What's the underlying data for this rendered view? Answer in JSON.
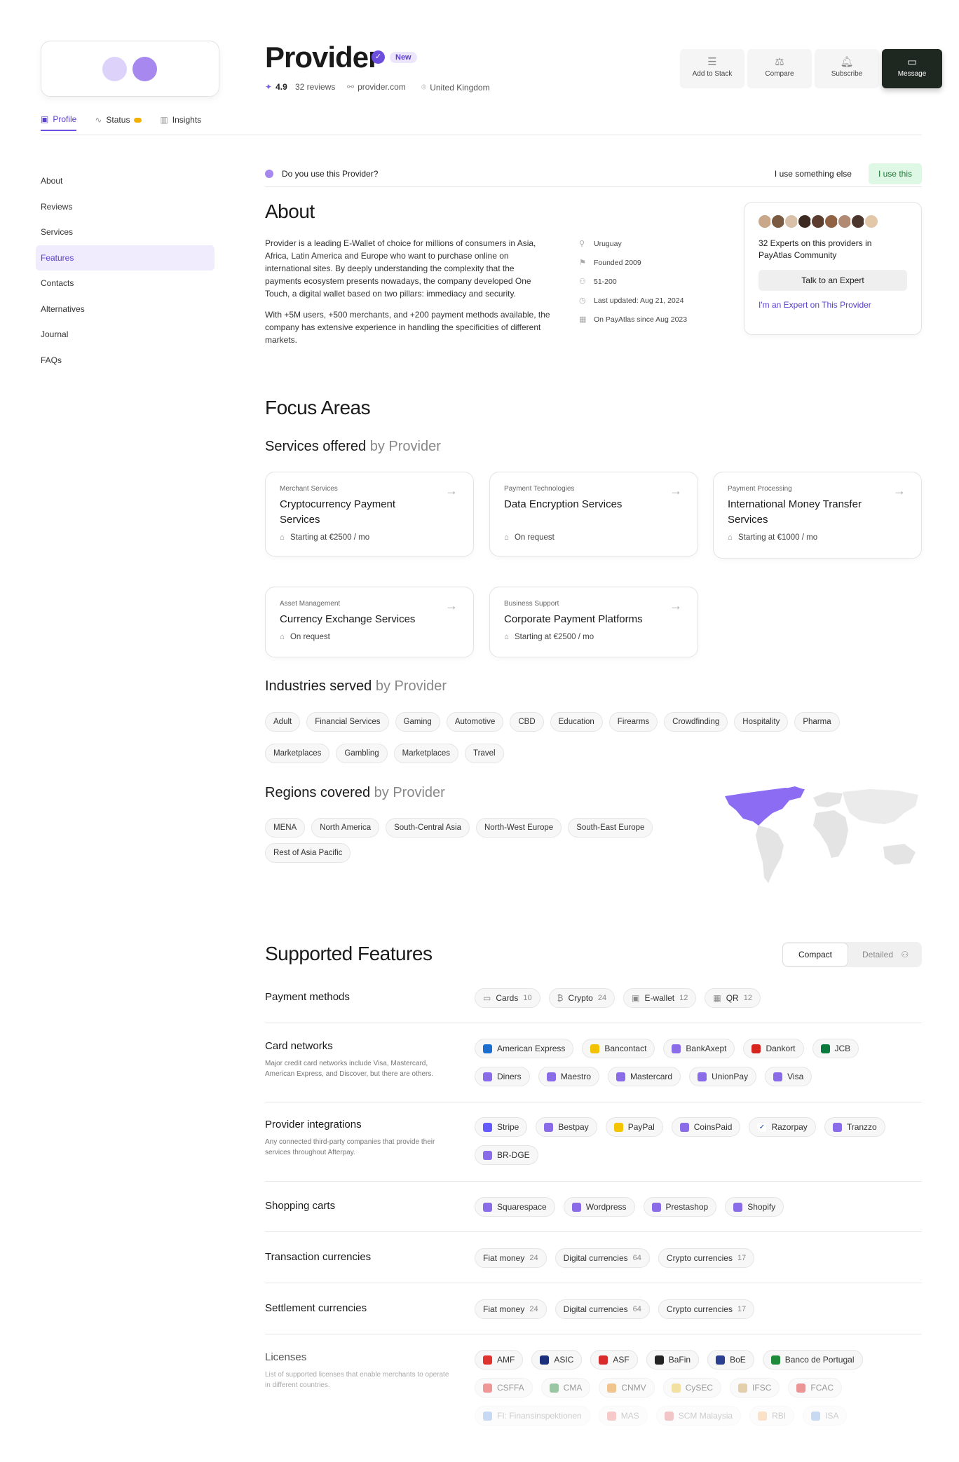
{
  "header": {
    "title": "Provider",
    "badge": "New",
    "rating": "4.9",
    "reviews": "32 reviews",
    "website": "provider.com",
    "country": "United Kingdom"
  },
  "actions": {
    "add_to_stack": "Add to Stack",
    "compare": "Compare",
    "subscribe": "Subscribe",
    "message": "Message"
  },
  "tabs": [
    {
      "label": "Profile"
    },
    {
      "label": "Status"
    },
    {
      "label": "Insights"
    }
  ],
  "sidebar": {
    "items": [
      {
        "label": "About"
      },
      {
        "label": "Reviews"
      },
      {
        "label": "Services"
      },
      {
        "label": "Features"
      },
      {
        "label": "Contacts"
      },
      {
        "label": "Alternatives"
      },
      {
        "label": "Journal"
      },
      {
        "label": "FAQs"
      }
    ]
  },
  "use_question": {
    "text": "Do you use this Provider?",
    "else_label": "I use something else",
    "use_label": "I use this"
  },
  "about": {
    "title": "About",
    "p1": "Provider is a leading E-Wallet of choice for millions of consumers in Asia, Africa, Latin America and Europe who want to purchase online on international sites. By deeply understanding the complexity that the payments ecosystem presents nowadays, the company developed One Touch, a digital wallet based on two pillars: immediacy and security.",
    "p2": "With +5M users, +500 merchants, and +200 payment methods available, the company has extensive experience in handling the specificities of different markets.",
    "facts": [
      "Uruguay",
      "Founded 2009",
      "51-200",
      "Last updated: Aug 21, 2024",
      "On PayAtlas since Aug 2023"
    ]
  },
  "experts": {
    "text": "32 Experts on this providers in PayAtlas Community",
    "talk": "Talk to an Expert",
    "link": "I'm an Expert on This Provider",
    "avatar_colors": [
      "#c9a78a",
      "#7a5a40",
      "#d8c1a8",
      "#3c2a22",
      "#5b3d2f",
      "#8e6242",
      "#b08a72",
      "#4a362c",
      "#e3c7a9"
    ]
  },
  "focus": {
    "title": "Focus Areas",
    "services_title": "Services offered",
    "by": "by Provider",
    "services": [
      {
        "category": "Merchant Services",
        "name": "Cryptocurrency Payment Services",
        "price": "Starting at €2500 / mo"
      },
      {
        "category": "Payment Technologies",
        "name": "Data Encryption Services",
        "price": "On request"
      },
      {
        "category": "Payment Processing",
        "name": "International Money Transfer Services",
        "price": "Starting at €1000 / mo"
      },
      {
        "category": "Asset Management",
        "name": "Currency Exchange Services",
        "price": "On request"
      },
      {
        "category": "Business Support",
        "name": "Corporate Payment Platforms",
        "price": "Starting at €2500 / mo"
      }
    ],
    "industries_title": "Industries served",
    "industries": [
      "Adult",
      "Financial Services",
      "Gaming",
      "Automotive",
      "CBD",
      "Education",
      "Firearms",
      "Crowdfinding",
      "Hospitality",
      "Pharma",
      "Marketplaces",
      "Gambling",
      "Marketplaces",
      "Travel"
    ],
    "regions_title": "Regions covered",
    "regions": [
      "MENA",
      "North America",
      "South-Central Asia",
      "North-West Europe",
      "South-East Europe",
      "Rest of Asia Pacific"
    ]
  },
  "features": {
    "title": "Supported Features",
    "seg_compact": "Compact",
    "seg_detailed": "Detailed",
    "payment_methods": {
      "label": "Payment methods",
      "items": [
        {
          "n": "Cards",
          "c": "10"
        },
        {
          "n": "Crypto",
          "c": "24"
        },
        {
          "n": "E-wallet",
          "c": "12"
        },
        {
          "n": "QR",
          "c": "12"
        }
      ]
    },
    "card_networks": {
      "label": "Card networks",
      "desc": "Major credit card networks include Visa, Mastercard, American Express, and Discover, but there are others.",
      "items": [
        "American Express",
        "Bancontact",
        "BankAxept",
        "Dankort",
        "JCB",
        "Diners",
        "Maestro",
        "Mastercard",
        "UnionPay",
        "Visa"
      ]
    },
    "integrations": {
      "label": "Provider integrations",
      "desc": "Any connected third-party companies that provide their services throughout Afterpay.",
      "items": [
        "Stripe",
        "Bestpay",
        "PayPal",
        "CoinsPaid",
        "Razorpay",
        "Tranzzo",
        "BR-DGE"
      ]
    },
    "carts": {
      "label": "Shopping carts",
      "items": [
        "Squarespace",
        "Wordpress",
        "Prestashop",
        "Shopify"
      ]
    },
    "tx_currencies": {
      "label": "Transaction currencies",
      "items": [
        {
          "n": "Fiat money",
          "c": "24"
        },
        {
          "n": "Digital currencies",
          "c": "64"
        },
        {
          "n": "Crypto currencies",
          "c": "17"
        }
      ]
    },
    "settle_currencies": {
      "label": "Settlement currencies",
      "items": [
        {
          "n": "Fiat money",
          "c": "24"
        },
        {
          "n": "Digital currencies",
          "c": "64"
        },
        {
          "n": "Crypto currencies",
          "c": "17"
        }
      ]
    },
    "licenses": {
      "label": "Licenses",
      "desc": "List of supported licenses that enable merchants to operate in different countries.",
      "items": [
        "AMF",
        "ASIC",
        "ASF",
        "BaFin",
        "BoE",
        "Banco de Portugal",
        "CSFFA",
        "CMA",
        "CNMV",
        "CySEC",
        "IFSC",
        "FCAC",
        "FI: Finansinspektionen",
        "MAS",
        "SCM Malaysia",
        "RBI",
        "ISA"
      ]
    }
  }
}
